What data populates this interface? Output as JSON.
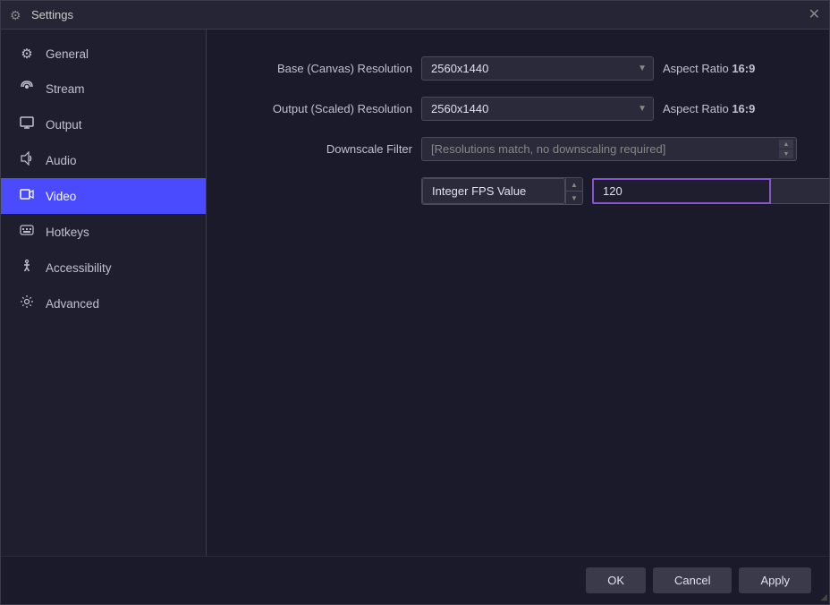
{
  "window": {
    "title": "Settings",
    "close_label": "✕"
  },
  "sidebar": {
    "items": [
      {
        "id": "general",
        "label": "General",
        "icon": "⚙"
      },
      {
        "id": "stream",
        "label": "Stream",
        "icon": "📡"
      },
      {
        "id": "output",
        "label": "Output",
        "icon": "🖥"
      },
      {
        "id": "audio",
        "label": "Audio",
        "icon": "🔊"
      },
      {
        "id": "video",
        "label": "Video",
        "icon": "🖱"
      },
      {
        "id": "hotkeys",
        "label": "Hotkeys",
        "icon": "⌨"
      },
      {
        "id": "accessibility",
        "label": "Accessibility",
        "icon": "♿"
      },
      {
        "id": "advanced",
        "label": "Advanced",
        "icon": "🔧"
      }
    ],
    "active": "video"
  },
  "form": {
    "base_resolution": {
      "label": "Base (Canvas) Resolution",
      "value": "2560x1440",
      "aspect_ratio": "Aspect Ratio ",
      "aspect_ratio_bold": "16:9"
    },
    "output_resolution": {
      "label": "Output (Scaled) Resolution",
      "value": "2560x1440",
      "aspect_ratio": "Aspect Ratio ",
      "aspect_ratio_bold": "16:9"
    },
    "downscale_filter": {
      "label": "Downscale Filter",
      "value": "[Resolutions match, no downscaling required]"
    },
    "fps": {
      "type_label": "Integer FPS Value",
      "value": "120"
    }
  },
  "buttons": {
    "ok": "OK",
    "cancel": "Cancel",
    "apply": "Apply"
  }
}
